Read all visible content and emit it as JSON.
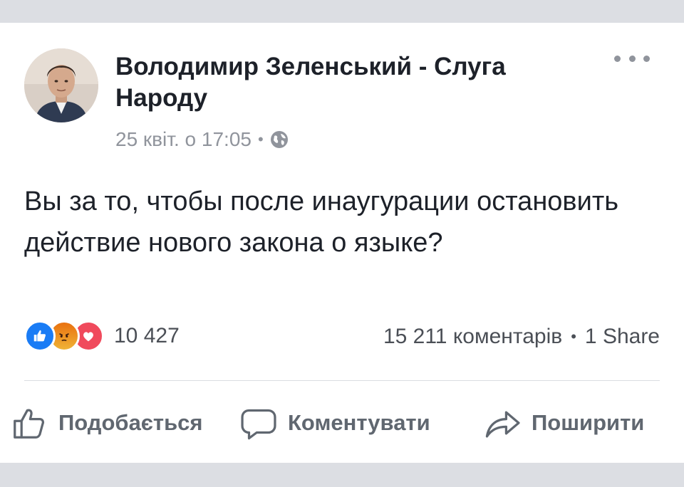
{
  "post": {
    "author": "Володимир Зеленський - Слуга Народу",
    "date": "25 квіт. о 17:05",
    "separator": "•",
    "text": "Вы за то, чтобы после инаугурации остановить действие нового закона о языке?"
  },
  "reactions": {
    "types": [
      "like-icon",
      "angry-icon",
      "love-icon"
    ],
    "count": "10 427"
  },
  "stats": {
    "comments": "15 211 коментарів",
    "separator": "•",
    "shares": "1 Share"
  },
  "actions": {
    "like_label": "Подобається",
    "comment_label": "Коментувати",
    "share_label": "Поширити"
  },
  "colors": {
    "accent": "#1a7cf5",
    "text": "#1d2129",
    "secondary": "#90949c"
  }
}
